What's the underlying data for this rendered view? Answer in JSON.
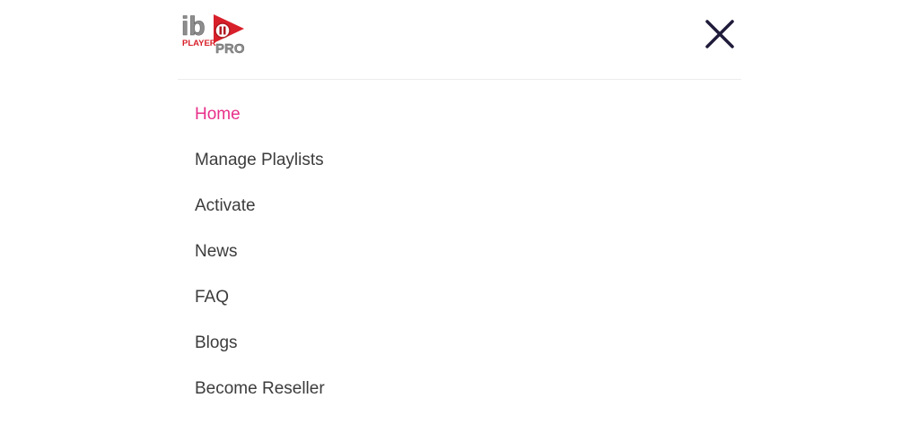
{
  "logo": {
    "text_ib": "ib",
    "text_player": "PLAYER",
    "text_pro": "PRO",
    "icon": "ibo-player-pro-logo"
  },
  "close_icon": "close-icon",
  "menu": {
    "items": [
      {
        "label": "Home",
        "active": true
      },
      {
        "label": "Manage Playlists",
        "active": false
      },
      {
        "label": "Activate",
        "active": false
      },
      {
        "label": "News",
        "active": false
      },
      {
        "label": "FAQ",
        "active": false
      },
      {
        "label": "Blogs",
        "active": false
      },
      {
        "label": "Become Reseller",
        "active": false
      }
    ]
  },
  "colors": {
    "active": "#e8308a",
    "text": "#3c3c3c",
    "close": "#1f1b3a",
    "brand_red": "#d8202a"
  }
}
